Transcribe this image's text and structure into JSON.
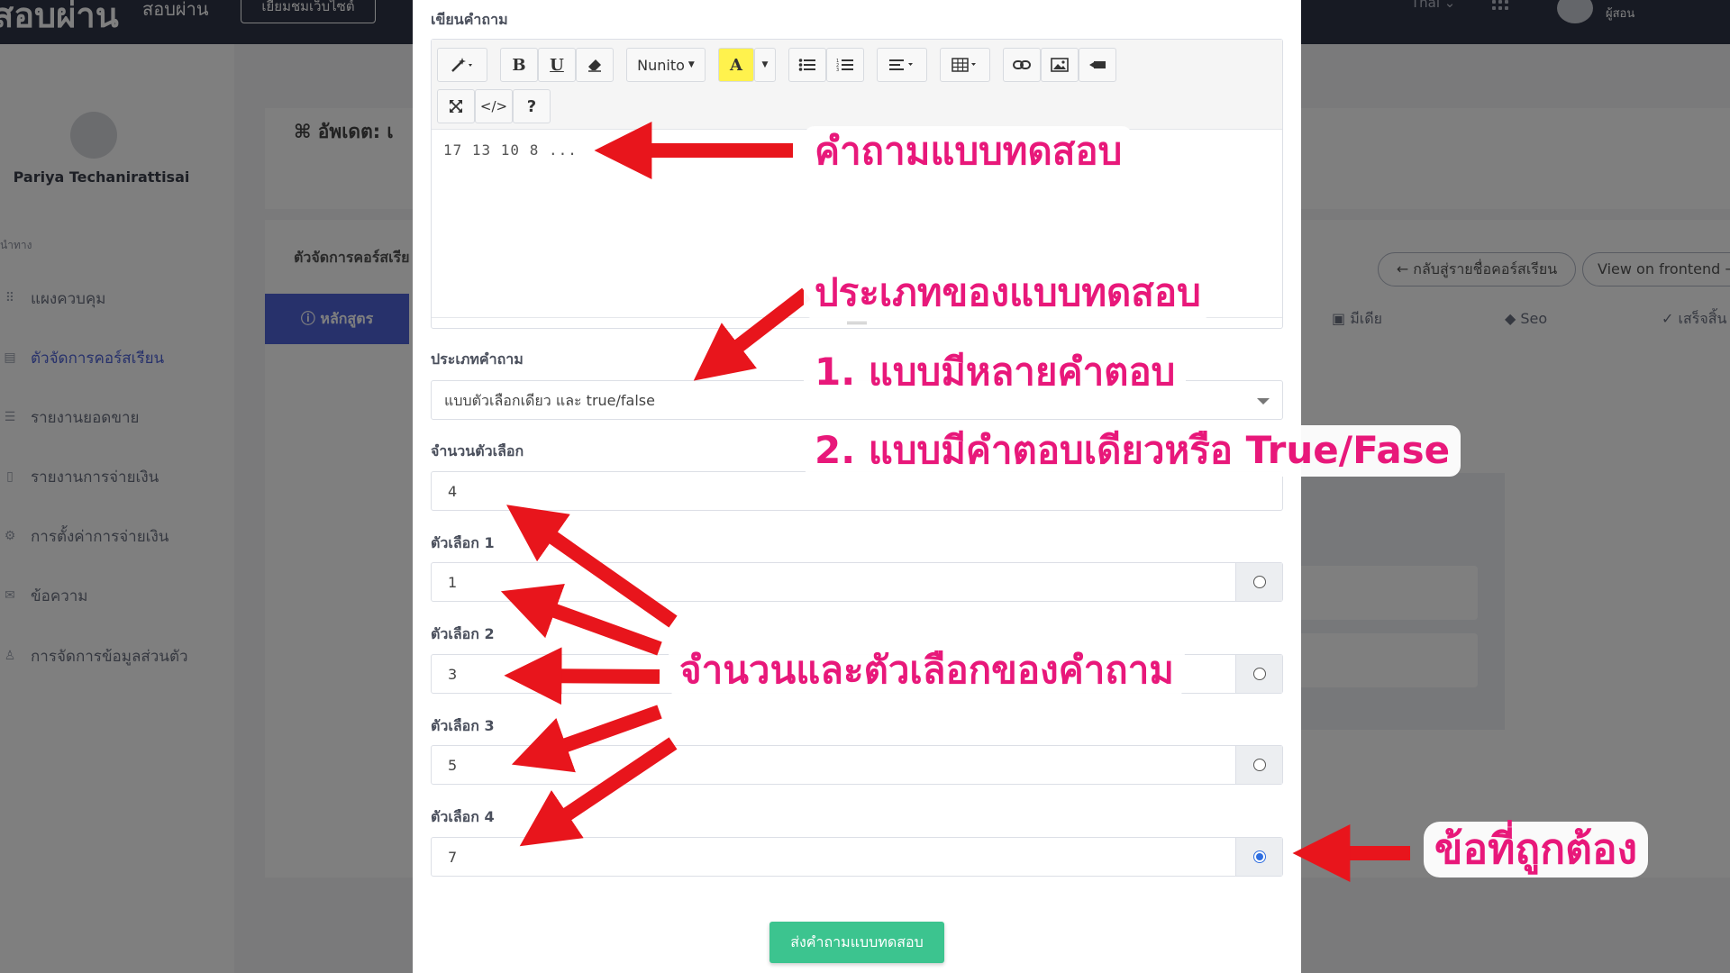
{
  "background": {
    "brand": "สอบผ่าน",
    "brand_sub": "สอบผ่าน",
    "visit_site": "เยี่ยมชมเว็บไซต์",
    "language": "Thai ⌄",
    "user_role": "ผู้สอน",
    "sidebar": {
      "user_name": "Pariya Techanirattisai",
      "section": "นำทาง",
      "items": [
        {
          "label": "แผงควบคุม",
          "icon": "dashboard-icon"
        },
        {
          "label": "ตัวจัดการคอร์สเรียน",
          "icon": "course-icon",
          "active": true
        },
        {
          "label": "รายงานยอดขาย",
          "icon": "report-icon"
        },
        {
          "label": "รายงานการจ่ายเงิน",
          "icon": "payment-report-icon"
        },
        {
          "label": "การตั้งค่าการจ่ายเงิน",
          "icon": "gear-icon"
        },
        {
          "label": "ข้อความ",
          "icon": "message-icon"
        },
        {
          "label": "การจัดการข้อมูลส่วนตัว",
          "icon": "profile-icon"
        }
      ]
    },
    "page_title": "อัพเดต: เ",
    "course_manager_title": "ตัวจัดการคอร์สเรีย",
    "tab_course": "หลักสูตร",
    "tab_media": "มีเดีย",
    "tab_seo": "Seo",
    "tab_finish": "เสร็จสิ้น",
    "back_button": "← กลับสู่รายชื่อคอร์สเรียน",
    "frontend_button": "View on frontend →"
  },
  "modal": {
    "question_label": "เขียนคำถาม",
    "toolbar": {
      "font_name": "Nunito",
      "bold": "B",
      "underline": "U",
      "code": "</>",
      "help": "?"
    },
    "question_text": "17  13  10  8  ...",
    "question_type_label": "ประเภทคำถาม",
    "question_type_value": "แบบตัวเลือกเดียว และ true/false",
    "option_count_label": "จำนวนตัวเลือก",
    "option_count_value": "4",
    "options": [
      {
        "label": "ตัวเลือก 1",
        "value": "1",
        "correct": false
      },
      {
        "label": "ตัวเลือก 2",
        "value": "3",
        "correct": false
      },
      {
        "label": "ตัวเลือก 3",
        "value": "5",
        "correct": false
      },
      {
        "label": "ตัวเลือก 4",
        "value": "7",
        "correct": true
      }
    ],
    "submit_button": "ส่งคำถามแบบทดสอบ"
  },
  "annotations": {
    "question": "คำถามแบบทดสอบ",
    "type_title": "ประเภทของแบบทดสอบ",
    "type_1": "1. แบบมีหลายคำตอบ",
    "type_2": "2. แบบมีคำตอบเดียวหรือ True/Fase",
    "options_note": "จำนวนและตัวเลือกของคำถาม",
    "correct": "ข้อที่ถูกต้อง",
    "arrow_color": "#e8151c",
    "text_color": "#e8187a"
  },
  "colors": {
    "accent": "#4e63d7",
    "submit": "#3cc48f",
    "radio_checked": "#2f6ee0",
    "topbar": "#2f3446"
  }
}
